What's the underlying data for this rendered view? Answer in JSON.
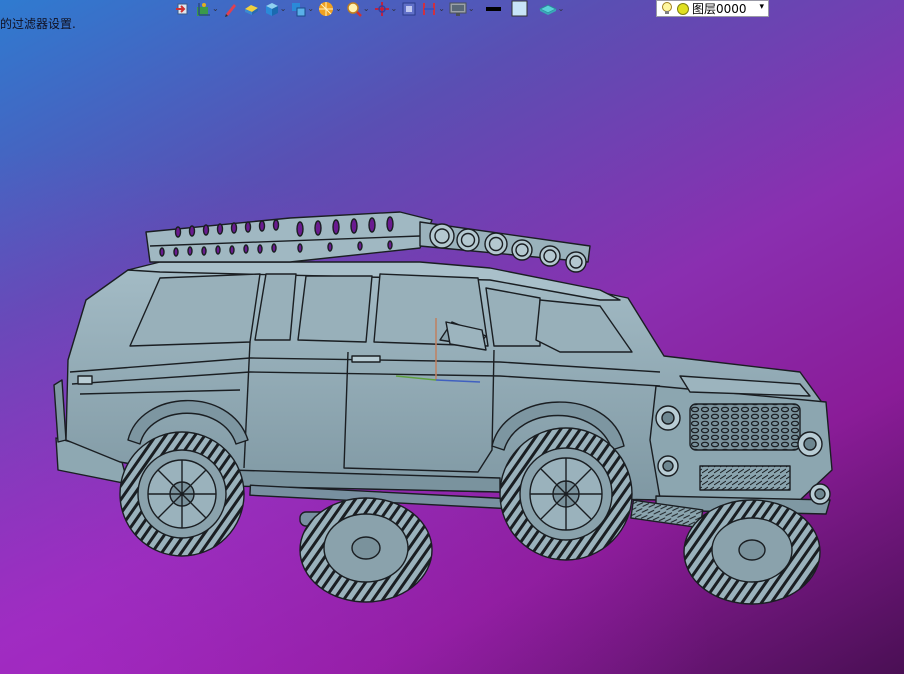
{
  "status": {
    "message": "的过滤器设置."
  },
  "toolbar": {
    "items": [
      {
        "icon": "view-orient-icon",
        "has_dropdown": false
      },
      {
        "icon": "axes-icon",
        "has_dropdown": true
      },
      {
        "icon": "pen-icon",
        "has_dropdown": false
      },
      {
        "icon": "box-highlight-icon",
        "has_dropdown": false
      },
      {
        "icon": "cube-icon",
        "has_dropdown": true
      },
      {
        "icon": "view-cube-icon",
        "has_dropdown": true
      },
      {
        "icon": "render-sphere-icon",
        "has_dropdown": true
      },
      {
        "icon": "zoom-icon",
        "has_dropdown": true
      },
      {
        "icon": "pan-cross-icon",
        "has_dropdown": true
      },
      {
        "icon": "frame-icon",
        "has_dropdown": false
      },
      {
        "icon": "section-icon",
        "has_dropdown": true
      },
      {
        "icon": "monitor-icon",
        "has_dropdown": true
      },
      {
        "icon": "line-color-icon",
        "has_dropdown": false
      },
      {
        "icon": "fill-color-icon",
        "has_dropdown": false
      },
      {
        "icon": "layer-plane-icon",
        "has_dropdown": true
      }
    ],
    "layer_select": {
      "value": "图层0000",
      "icons": [
        "lightbulb-icon",
        "sun-icon"
      ]
    }
  },
  "viewport": {
    "model": "off-road-suv-wireframe",
    "colors": {
      "body": "#8fa9b4",
      "edge": "#1a1e22",
      "bg_top_left": "#2f7bd0",
      "bg_bottom_right": "#4a0f54"
    }
  }
}
